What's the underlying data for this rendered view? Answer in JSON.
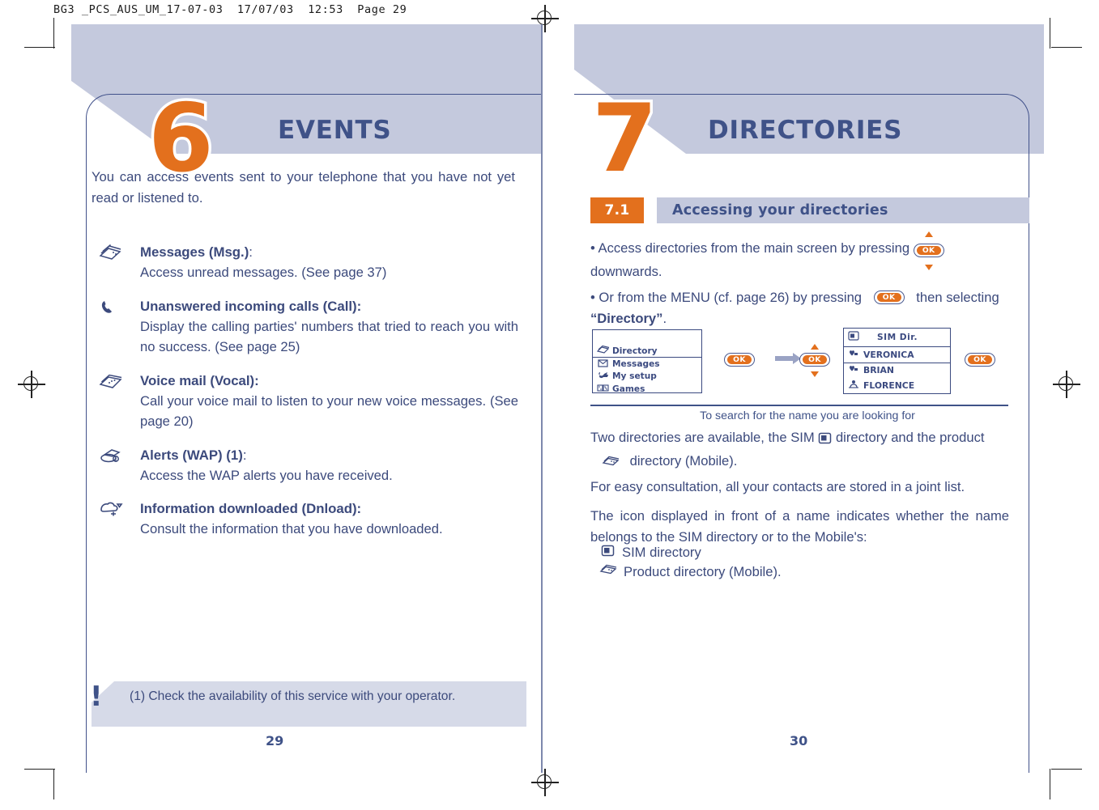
{
  "print_header": "BG3 _PCS_AUS_UM_17-07-03  17/07/03  12:53  Page 29",
  "colors": {
    "banner": "#c4c9dd",
    "accent_orange": "#e3701d",
    "text_navy": "#3c4a7c",
    "title_navy": "#3f5288",
    "frame_border": "#41518a"
  },
  "left_page": {
    "chapter_number": "6",
    "chapter_title": "EVENTS",
    "intro": "You can access events sent to your telephone that you have not yet read or listened to.",
    "items": [
      {
        "icon": "messages-icon",
        "title": "Messages (Msg.)",
        "title_suffix": ":",
        "description": "Access unread messages. (See page 37)"
      },
      {
        "icon": "missed-call-handset-icon",
        "title": "Unanswered incoming calls (Call):",
        "title_suffix": "",
        "description": "Display the calling parties' numbers that tried to reach you with no success. (See page 25)"
      },
      {
        "icon": "voice-mail-icon",
        "title": "Voice mail (Vocal):",
        "title_suffix": "",
        "description": "Call your voice mail to listen to your new voice messages. (See page 20)"
      },
      {
        "icon": "wap-alert-icon",
        "title": "Alerts (WAP) (1)",
        "title_suffix": ":",
        "description": "Access the WAP alerts you have received."
      },
      {
        "icon": "download-icon",
        "title": "Information downloaded (Dnload):",
        "title_suffix": "",
        "description": "Consult the information that you have downloaded."
      }
    ],
    "footnote": {
      "marker": "!",
      "text": "(1) Check the availability of this service with your operator."
    },
    "page_number": "29"
  },
  "right_page": {
    "chapter_number": "7",
    "chapter_title": "DIRECTORIES",
    "section": {
      "number": "7.1",
      "title": "Accessing your directories"
    },
    "bullets": [
      {
        "before": "• Access  directories  from  the  main  screen  by  pressing",
        "key": "OK",
        "key_style": "with-up-down-arrows",
        "after": "downwards."
      },
      {
        "before": "• Or from the MENU (cf. page 26) by pressing",
        "key": "OK",
        "key_style": "plain",
        "after_plain": "then selecting",
        "after_bold": "“Directory”",
        "after_tail": "."
      }
    ],
    "diagram": {
      "screen_1": {
        "rows": [
          {
            "icon": "directory-cards-icon",
            "label": "Directory",
            "highlighted": true
          },
          {
            "icon": "envelope-icon",
            "label": "Messages",
            "highlighted": false
          },
          {
            "icon": "my-setup-icon",
            "label": "My setup",
            "highlighted": false
          },
          {
            "icon": "dice-games-icon",
            "label": "Games",
            "highlighted": false
          }
        ]
      },
      "key_1": "OK",
      "key_2": "OK",
      "key_3": "OK",
      "arrow": "right-arrow-icon",
      "screen_2": {
        "header_icon": "sim-card-icon",
        "header": "SIM Dir.",
        "rows": [
          {
            "icon": "sim-contact-icon",
            "label": "VERONICA",
            "highlighted": true
          },
          {
            "icon": "sim-contact-icon",
            "label": "BRIAN",
            "highlighted": false
          },
          {
            "icon": "mobile-contact-icon",
            "label": "FLORENCE",
            "highlighted": false
          }
        ]
      },
      "caption": "To search for the name you are looking for"
    },
    "paragraphs": {
      "p1_a": "Two directories are available, the SIM",
      "p1_icon1": "sim-card-icon",
      "p1_b": "directory and the product",
      "p1_icon2": "directory-cards-icon",
      "p1_c": "directory (Mobile).",
      "p2": "For easy consultation, all your contacts are stored in a joint list.",
      "p3": "The icon displayed in front of a name indicates whether the name belongs to the SIM directory or to the Mobile's:",
      "legend": [
        {
          "icon": "sim-card-icon",
          "label": "SIM directory"
        },
        {
          "icon": "directory-cards-icon",
          "label": "Product directory (Mobile)."
        }
      ]
    },
    "page_number": "30"
  }
}
